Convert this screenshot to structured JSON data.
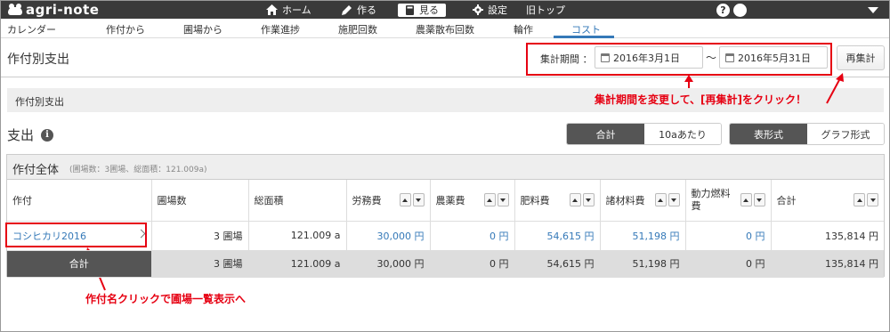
{
  "app": {
    "logo_text": "agri-note"
  },
  "topnav": {
    "home": "ホーム",
    "create": "作る",
    "view": "見る",
    "settings": "設定",
    "old_top": "旧トップ",
    "help": "?"
  },
  "subtabs": [
    "カレンダー",
    "作付から",
    "圃場から",
    "作業進捗",
    "施肥回数",
    "農薬散布回数",
    "輪作",
    "コスト"
  ],
  "page": {
    "title": "作付別支出",
    "period_label": "集計期間 ：",
    "date_from": "2016年3月1日",
    "date_to": "2016年5月31日",
    "tilde": "〜",
    "recalc_button": "再集計",
    "section_title": "作付別支出"
  },
  "annotations": {
    "period": "集計期間を変更して、[再集計]をクリック！",
    "crop": "作付名クリックで圃場一覧表示へ"
  },
  "expense": {
    "heading": "支出",
    "info": "i",
    "toggle_total": "合計",
    "toggle_per10a": "10aあたり",
    "toggle_table": "表形式",
    "toggle_graph": "グラフ形式"
  },
  "table": {
    "title": "作付全体",
    "subtitle": "(圃場数：3圃場、総面積：121.009a)",
    "headers": [
      "作付",
      "圃場数",
      "総面積",
      "労務費",
      "農薬費",
      "肥料費",
      "諸材料費",
      "動力燃料費",
      "合計"
    ],
    "rows": [
      {
        "crop": "コシヒカリ2016",
        "fields": "3 圃場",
        "area": "121.009 a",
        "labor": "30,000 円",
        "pesticide": "0 円",
        "fertilizer": "54,615 円",
        "materials": "51,198 円",
        "fuel": "0 円",
        "total": "135,814 円"
      }
    ],
    "total_row": {
      "label": "合計",
      "fields": "3 圃場",
      "area": "121.009 a",
      "labor": "30,000 円",
      "pesticide": "0 円",
      "fertilizer": "54,615 円",
      "materials": "51,198 円",
      "fuel": "0 円",
      "total": "135,814 円"
    }
  },
  "colors": {
    "accent": "#3579b8",
    "annotation": "#e60012",
    "topbar": "#3a3a3a"
  }
}
